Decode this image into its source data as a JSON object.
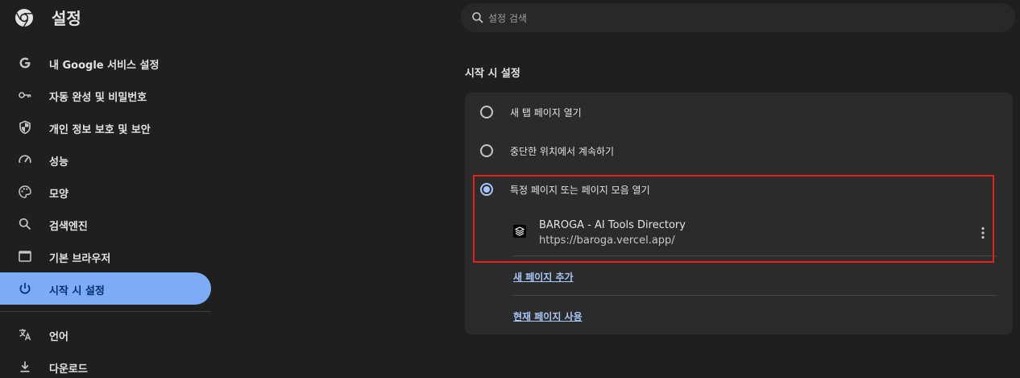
{
  "header": {
    "title": "설정",
    "search_placeholder": "설정 검색"
  },
  "sidebar": {
    "items": [
      {
        "label": "내 Google 서비스 설정",
        "icon": "google-g-icon"
      },
      {
        "label": "자동 완성 및 비밀번호",
        "icon": "key-icon"
      },
      {
        "label": "개인 정보 보호 및 보안",
        "icon": "shield-icon"
      },
      {
        "label": "성능",
        "icon": "speedometer-icon"
      },
      {
        "label": "모양",
        "icon": "palette-icon"
      },
      {
        "label": "검색엔진",
        "icon": "search-icon"
      },
      {
        "label": "기본 브라우저",
        "icon": "browser-window-icon"
      },
      {
        "label": "시작 시 설정",
        "icon": "power-icon",
        "active": true
      },
      {
        "label": "언어",
        "icon": "translate-icon"
      },
      {
        "label": "다운로드",
        "icon": "download-icon"
      }
    ]
  },
  "main": {
    "section_title": "시작 시 설정",
    "options": [
      {
        "label": "새 탭 페이지 열기",
        "checked": false
      },
      {
        "label": "중단한 위치에서 계속하기",
        "checked": false
      },
      {
        "label": "특정 페이지 또는 페이지 모음 열기",
        "checked": true
      }
    ],
    "page_entry": {
      "name": "BAROGA - AI Tools Directory",
      "url": "https://baroga.vercel.app/"
    },
    "add_page_link": "새 페이지 추가",
    "use_current_link": "현재 페이지 사용"
  },
  "colors": {
    "background": "#1f1f1f",
    "card": "#2b2b2b",
    "accent": "#a8c7fa",
    "active_nav": "#7cacf8",
    "highlight": "#e2231a"
  }
}
